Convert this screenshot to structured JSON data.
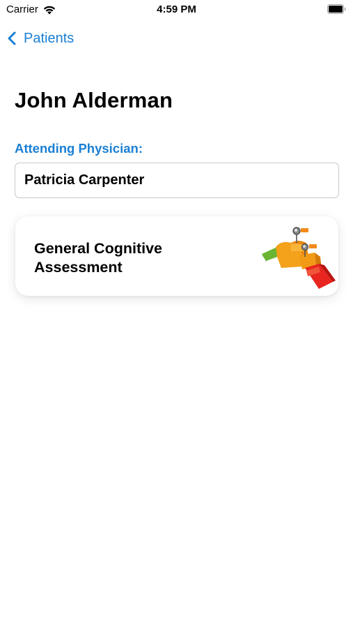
{
  "status_bar": {
    "carrier": "Carrier",
    "time": "4:59 PM",
    "icons": [
      "wifi-icon",
      "battery-icon"
    ]
  },
  "nav": {
    "back_label": "Patients",
    "back_icon": "chevron-left-icon"
  },
  "patient": {
    "name": "John Alderman"
  },
  "physician": {
    "label": "Attending Physician:",
    "value": "Patricia Carpenter"
  },
  "assessments": [
    {
      "title": "General Cognitive Assessment",
      "icon": "assessment-ladder-illustration"
    }
  ],
  "colors": {
    "accent": "#1a7fd4",
    "text": "#000000",
    "background": "#ffffff"
  }
}
